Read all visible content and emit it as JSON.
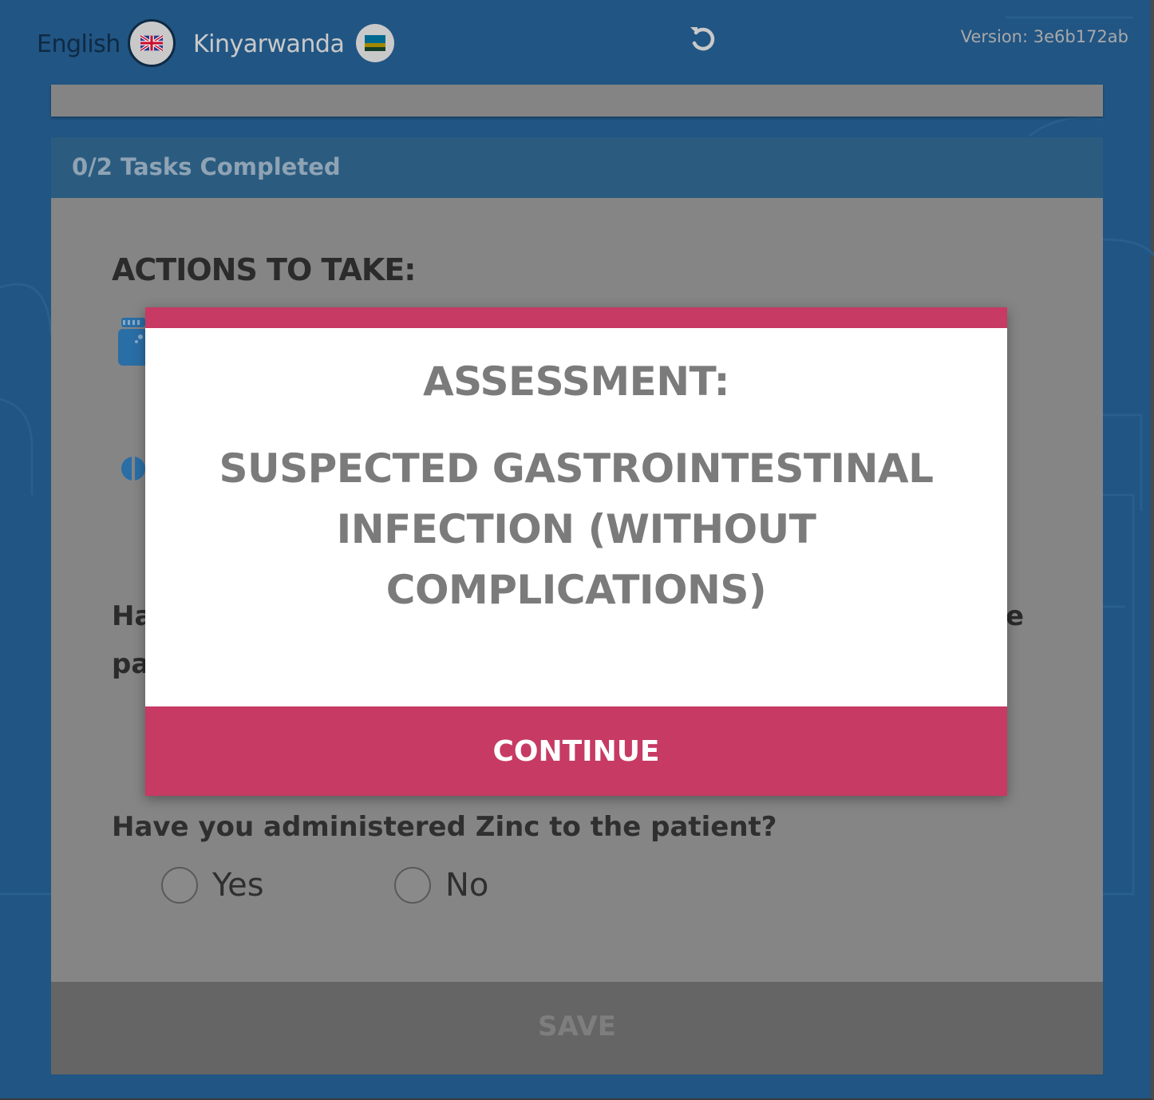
{
  "header": {
    "languages": [
      {
        "label": "English",
        "flag": "uk-flag-icon",
        "selected": true
      },
      {
        "label": "Kinyarwanda",
        "flag": "rwanda-flag-icon",
        "selected": false
      }
    ],
    "reset_icon": "reset-icon",
    "version": "Version: 3e6b172ab"
  },
  "tasks": {
    "progress_label": "0/2 Tasks Completed"
  },
  "content": {
    "actions_title": "ACTIONS TO TAKE:",
    "partial_text_1": "Ha",
    "partial_text_2": "pa",
    "partial_text_3": "e",
    "zinc_question": "Have you administered Zinc to the patient?",
    "options": [
      {
        "label": "Yes",
        "checked": false
      },
      {
        "label": "No",
        "checked": false
      }
    ],
    "save_label": "SAVE"
  },
  "modal": {
    "heading": "ASSESSMENT:",
    "assessment": "SUSPECTED GASTROINTESTINAL INFECTION (WITHOUT COMPLICATIONS)",
    "continue_label": "CONTINUE"
  },
  "colors": {
    "background": "#215583",
    "accent": "#c63a64",
    "tasks_bar": "#2b5c80"
  }
}
